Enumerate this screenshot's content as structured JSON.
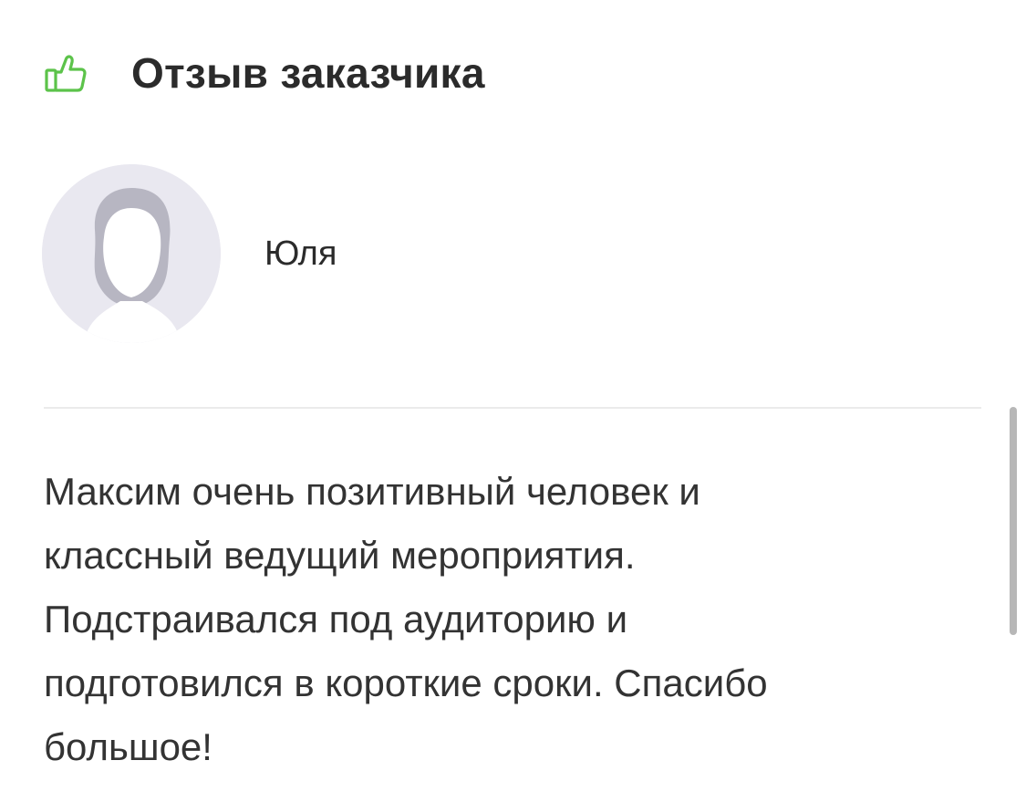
{
  "header": {
    "icon": "thumbs-up-icon",
    "icon_color": "#5cc34a",
    "title": "Отзыв заказчика"
  },
  "author": {
    "avatar": "default-avatar-silhouette",
    "name": "Юля"
  },
  "review": {
    "lines": [
      "Максим очень позитивный человек и",
      "классный ведущий мероприятия.",
      "Подстраивался под аудиторию и",
      "подготовился в короткие сроки. Спасибо",
      "большое!"
    ]
  }
}
